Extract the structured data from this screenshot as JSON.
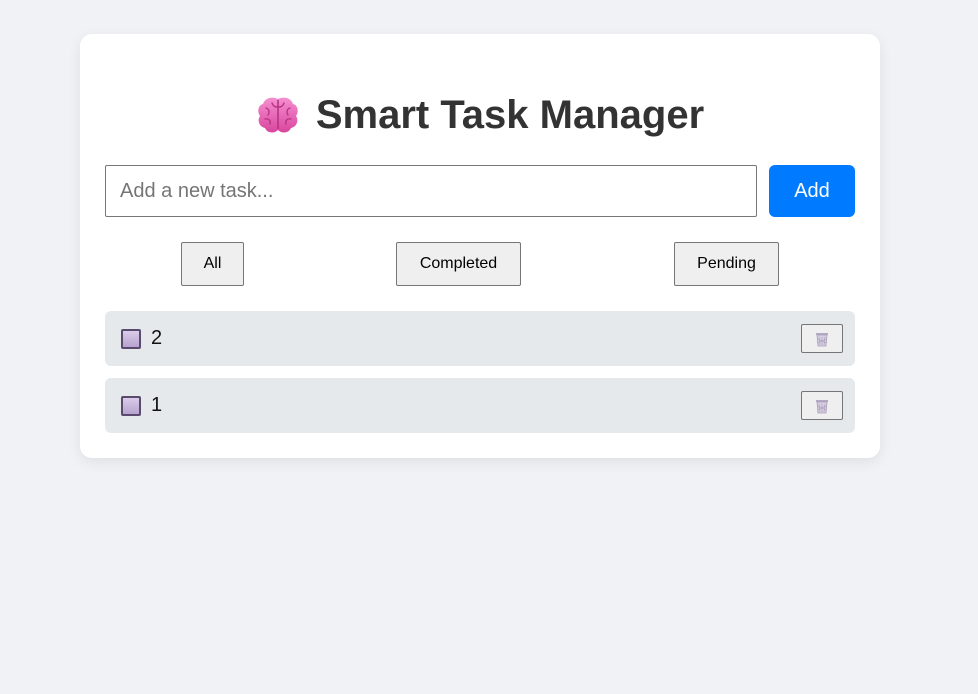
{
  "header": {
    "title": "Smart Task Manager",
    "title_icon": "brain-icon"
  },
  "input": {
    "placeholder": "Add a new task...",
    "value": "",
    "add_label": "Add"
  },
  "filters": [
    {
      "label": "All"
    },
    {
      "label": "Completed"
    },
    {
      "label": "Pending"
    }
  ],
  "tasks": [
    {
      "text": "2",
      "completed": false,
      "delete_icon": "trash-icon"
    },
    {
      "text": "1",
      "completed": false,
      "delete_icon": "trash-icon"
    }
  ],
  "colors": {
    "accent": "#007bff",
    "background": "#f0f2f5",
    "task_bg": "#e6e9ec"
  }
}
